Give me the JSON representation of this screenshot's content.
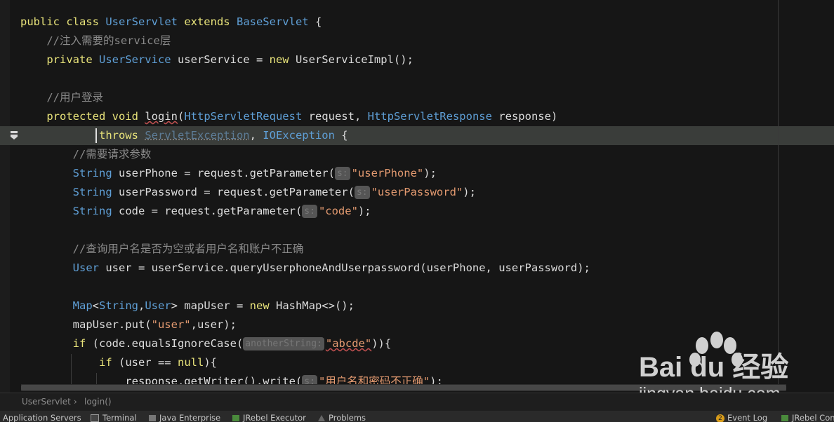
{
  "editor": {
    "lines": [
      {
        "tokens": [
          {
            "t": "public class ",
            "c": "kw"
          },
          {
            "t": "UserServlet",
            "c": "ty"
          },
          {
            "t": " extends ",
            "c": "kw"
          },
          {
            "t": "BaseServlet",
            "c": "ty"
          },
          {
            "t": " {",
            "c": "var"
          }
        ]
      },
      {
        "tokens": [
          {
            "t": "    //注入需要的service层",
            "c": "cm"
          }
        ]
      },
      {
        "tokens": [
          {
            "t": "    private ",
            "c": "kw"
          },
          {
            "t": "UserService",
            "c": "ty"
          },
          {
            "t": " userService = ",
            "c": "var"
          },
          {
            "t": "new ",
            "c": "kw"
          },
          {
            "t": "UserServiceImpl();",
            "c": "var"
          }
        ]
      },
      {
        "tokens": []
      },
      {
        "tokens": [
          {
            "t": "    //用户登录",
            "c": "cm"
          }
        ]
      },
      {
        "tokens": [
          {
            "t": "    protected void ",
            "c": "kw"
          },
          {
            "t": "login",
            "c": "fn err"
          },
          {
            "t": "(",
            "c": "var"
          },
          {
            "t": "HttpServletRequest",
            "c": "ty"
          },
          {
            "t": " request, ",
            "c": "var"
          },
          {
            "t": "HttpServletResponse",
            "c": "ty"
          },
          {
            "t": " response)",
            "c": "var"
          }
        ]
      },
      {
        "tokens": [
          {
            "t": "            throws ",
            "c": "kw"
          },
          {
            "t": "ServletException",
            "c": "dim"
          },
          {
            "t": ", ",
            "c": "var"
          },
          {
            "t": "IOException",
            "c": "ty"
          },
          {
            "t": " {",
            "c": "var"
          }
        ]
      },
      {
        "tokens": [
          {
            "t": "        //需要请求参数",
            "c": "cm"
          }
        ]
      },
      {
        "tokens": [
          {
            "t": "        ",
            "c": "var"
          },
          {
            "t": "String",
            "c": "ty"
          },
          {
            "t": " userPhone = request.getParameter(",
            "c": "var"
          },
          {
            "t": "s:",
            "c": "hint"
          },
          {
            "t": "\"userPhone\"",
            "c": "str"
          },
          {
            "t": ");",
            "c": "var"
          }
        ]
      },
      {
        "tokens": [
          {
            "t": "        ",
            "c": "var"
          },
          {
            "t": "String",
            "c": "ty"
          },
          {
            "t": " userPassword = request.getParameter(",
            "c": "var"
          },
          {
            "t": "s:",
            "c": "hint"
          },
          {
            "t": "\"userPassword\"",
            "c": "str"
          },
          {
            "t": ");",
            "c": "var"
          }
        ]
      },
      {
        "tokens": [
          {
            "t": "        ",
            "c": "var"
          },
          {
            "t": "String",
            "c": "ty"
          },
          {
            "t": " code = request.getParameter(",
            "c": "var"
          },
          {
            "t": "s:",
            "c": "hint"
          },
          {
            "t": "\"code\"",
            "c": "str"
          },
          {
            "t": ");",
            "c": "var"
          }
        ]
      },
      {
        "tokens": []
      },
      {
        "tokens": [
          {
            "t": "        //查询用户名是否为空或者用户名和账户不正确",
            "c": "cm"
          }
        ]
      },
      {
        "tokens": [
          {
            "t": "        ",
            "c": "var"
          },
          {
            "t": "User",
            "c": "ty"
          },
          {
            "t": " user = userService.queryUserphoneAndUserpassword(userPhone, userPassword);",
            "c": "var"
          }
        ]
      },
      {
        "tokens": []
      },
      {
        "tokens": [
          {
            "t": "        ",
            "c": "var"
          },
          {
            "t": "Map",
            "c": "ty"
          },
          {
            "t": "<",
            "c": "var"
          },
          {
            "t": "String",
            "c": "ty"
          },
          {
            "t": ",",
            "c": "var"
          },
          {
            "t": "User",
            "c": "ty"
          },
          {
            "t": "> mapUser = ",
            "c": "var"
          },
          {
            "t": "new ",
            "c": "kw"
          },
          {
            "t": "HashMap<>();",
            "c": "var"
          }
        ]
      },
      {
        "tokens": [
          {
            "t": "        mapUser.put(",
            "c": "var"
          },
          {
            "t": "\"user\"",
            "c": "str"
          },
          {
            "t": ",user);",
            "c": "var"
          }
        ]
      },
      {
        "tokens": [
          {
            "t": "        ",
            "c": "var"
          },
          {
            "t": "if ",
            "c": "kw"
          },
          {
            "t": "(code.equalsIgnoreCase(",
            "c": "var"
          },
          {
            "t": "anotherString:",
            "c": "hint"
          },
          {
            "t": "\"abcde\"",
            "c": "str err"
          },
          {
            "t": ")){",
            "c": "var"
          }
        ]
      },
      {
        "tokens": [
          {
            "t": "            ",
            "c": "var"
          },
          {
            "t": "if ",
            "c": "kw"
          },
          {
            "t": "(user == ",
            "c": "var"
          },
          {
            "t": "null",
            "c": "kw"
          },
          {
            "t": "){",
            "c": "var"
          }
        ]
      },
      {
        "tokens": [
          {
            "t": "                response.getWriter().write(",
            "c": "var"
          },
          {
            "t": "s:",
            "c": "hint"
          },
          {
            "t": "\"用户名和密码不正确\"",
            "c": "str"
          },
          {
            "t": ");",
            "c": "var"
          }
        ]
      }
    ]
  },
  "breadcrumb": {
    "class_name": "UserServlet",
    "separator": "›",
    "method_name": "login()"
  },
  "tool_windows": [
    {
      "label": "Application Servers",
      "icon": "server-icon"
    },
    {
      "label": "Terminal",
      "icon": "terminal-icon"
    },
    {
      "label": "Java Enterprise",
      "icon": "java-enterprise-icon"
    },
    {
      "label": "JRebel Executor",
      "icon": "jrebel-icon"
    },
    {
      "label": "Problems",
      "icon": "warning-icon"
    },
    {
      "label": "Event Log",
      "icon": "event-log-icon",
      "badge": "2"
    },
    {
      "label": "JRebel Cons",
      "icon": "jrebel-icon"
    }
  ],
  "watermark": {
    "brand_text": "Bai du 经验",
    "url_text": "jingyan.baidu.com"
  },
  "colors": {
    "keyword": "#e8e37a",
    "type": "#5f9fd6",
    "comment": "#8a8a8a",
    "string": "#e39a70",
    "background": "#161616"
  }
}
